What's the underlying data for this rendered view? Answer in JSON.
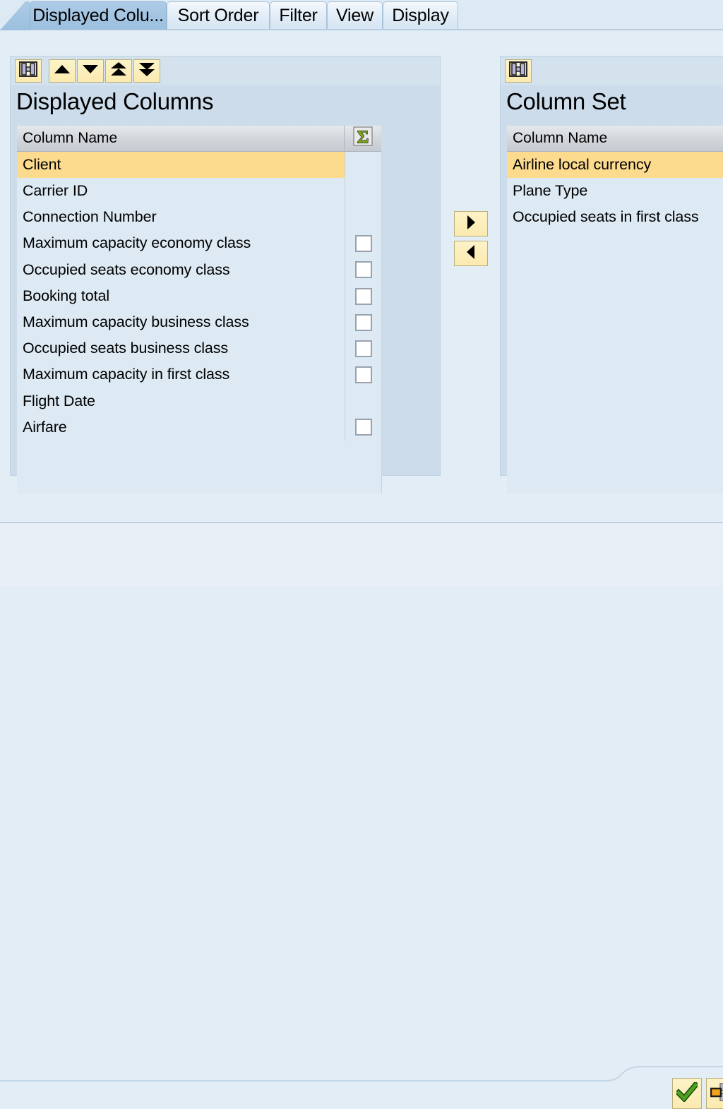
{
  "tabs": [
    {
      "label": "Displayed Colu...",
      "active": true,
      "name": "tab-displayed-columns"
    },
    {
      "label": "Sort Order",
      "active": false,
      "name": "tab-sort-order"
    },
    {
      "label": "Filter",
      "active": false,
      "name": "tab-filter"
    },
    {
      "label": "View",
      "active": false,
      "name": "tab-view"
    },
    {
      "label": "Display",
      "active": false,
      "name": "tab-display"
    }
  ],
  "displayed_columns": {
    "title": "Displayed Columns",
    "toolbar": [
      {
        "icon": "find-icon",
        "label": "Find"
      },
      {
        "icon": "arrow-up-icon",
        "label": "Move Up"
      },
      {
        "icon": "arrow-down-icon",
        "label": "Move Down"
      },
      {
        "icon": "arrow-top-icon",
        "label": "Move to Top"
      },
      {
        "icon": "arrow-bottom-icon",
        "label": "Move to Bottom"
      }
    ],
    "header": {
      "name": "Column Name",
      "sum_icon": "sum-sigma-icon"
    },
    "rows": [
      {
        "label": "Client",
        "selected": true,
        "checkbox": false,
        "checked": false
      },
      {
        "label": "Carrier ID",
        "selected": false,
        "checkbox": false,
        "checked": false
      },
      {
        "label": "Connection Number",
        "selected": false,
        "checkbox": false,
        "checked": false
      },
      {
        "label": "Maximum capacity economy class",
        "selected": false,
        "checkbox": true,
        "checked": false
      },
      {
        "label": "Occupied seats economy class",
        "selected": false,
        "checkbox": true,
        "checked": false
      },
      {
        "label": "Booking total",
        "selected": false,
        "checkbox": true,
        "checked": false
      },
      {
        "label": "Maximum capacity business class",
        "selected": false,
        "checkbox": true,
        "checked": false
      },
      {
        "label": "Occupied seats business class",
        "selected": false,
        "checkbox": true,
        "checked": false
      },
      {
        "label": "Maximum capacity in first class",
        "selected": false,
        "checkbox": true,
        "checked": false
      },
      {
        "label": "Flight Date",
        "selected": false,
        "checkbox": false,
        "checked": false
      },
      {
        "label": "Airfare",
        "selected": false,
        "checkbox": true,
        "checked": false
      }
    ]
  },
  "column_set": {
    "title": "Column Set",
    "toolbar": [
      {
        "icon": "find-icon",
        "label": "Find"
      }
    ],
    "header": {
      "name": "Column Name"
    },
    "rows": [
      {
        "label": "Airline local currency",
        "selected": true
      },
      {
        "label": "Plane Type",
        "selected": false
      },
      {
        "label": "Occupied seats in first class",
        "selected": false
      }
    ]
  },
  "transfer": [
    {
      "icon": "arrow-right-icon",
      "label": "Add to Displayed Columns"
    },
    {
      "icon": "arrow-left-icon",
      "label": "Remove from Displayed Columns"
    }
  ],
  "bottom_actions": [
    {
      "icon": "check-green-icon",
      "label": "Copy"
    },
    {
      "icon": "layout-grid-icon",
      "label": "Layout"
    }
  ],
  "colors": {
    "tab_active": "#a3c4e2",
    "tab_inactive": "#dfebf6",
    "panel_bg": "#ccdceb",
    "list_bg": "#dde9f3",
    "row_selected": "#fcdb8f",
    "header_gray": "#d2d6da",
    "button_yellow": "#fbeab0",
    "sigma_green": "#7aa81e",
    "check_green": "#3f9c1e",
    "page_bg": "#e3edf5",
    "bottom_bar": "#e9eff6"
  }
}
